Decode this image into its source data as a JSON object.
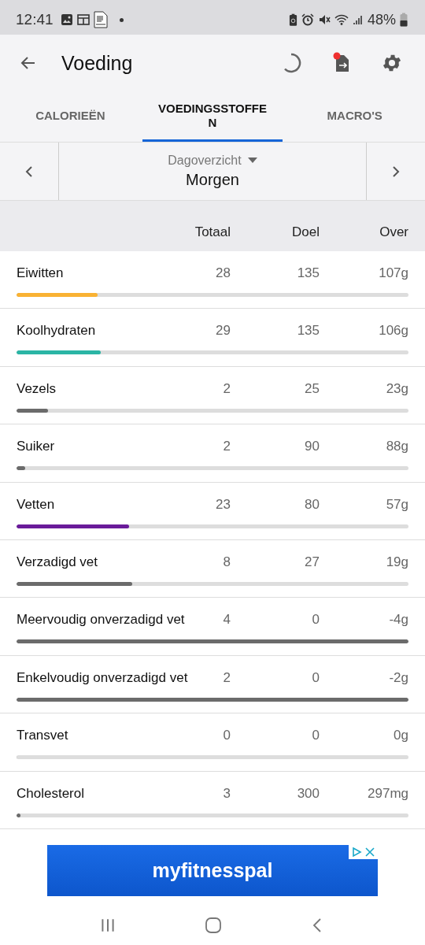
{
  "status_bar": {
    "time": "12:41",
    "battery": "48%"
  },
  "app_bar": {
    "title": "Voeding"
  },
  "tabs": [
    {
      "label": "CALORIEËN",
      "selected": false
    },
    {
      "label": "VOEDINGSSTOFFEN",
      "selected": true
    },
    {
      "label": "MACRO'S",
      "selected": false
    }
  ],
  "date_nav": {
    "view": "Dagoverzicht",
    "day": "Morgen"
  },
  "table": {
    "columns": [
      "Totaal",
      "Doel",
      "Over"
    ],
    "rows": [
      {
        "name": "Eiwitten",
        "total": "28",
        "goal": "135",
        "left": "107g",
        "level": 0.207,
        "color": "#f9b233"
      },
      {
        "name": "Koolhydraten",
        "total": "29",
        "goal": "135",
        "left": "106g",
        "level": 0.215,
        "color": "#2bb5a5"
      },
      {
        "name": "Vezels",
        "total": "2",
        "goal": "25",
        "left": "23g",
        "level": 0.08,
        "color": "#6b6b6b"
      },
      {
        "name": "Suiker",
        "total": "2",
        "goal": "90",
        "left": "88g",
        "level": 0.022,
        "color": "#6b6b6b"
      },
      {
        "name": "Vetten",
        "total": "23",
        "goal": "80",
        "left": "57g",
        "level": 0.288,
        "color": "#6a1b9a"
      },
      {
        "name": "Verzadigd vet",
        "total": "8",
        "goal": "27",
        "left": "19g",
        "level": 0.296,
        "color": "#6b6b6b"
      },
      {
        "name": "Meervoudig onverzadigd vet",
        "total": "4",
        "goal": "0",
        "left": "-4g",
        "level": 1,
        "color": "#6b6b6b"
      },
      {
        "name": "Enkelvoudig onverzadigd vet",
        "total": "2",
        "goal": "0",
        "left": "-2g",
        "level": 1,
        "color": "#6b6b6b"
      },
      {
        "name": "Transvet",
        "total": "0",
        "goal": "0",
        "left": "0g",
        "level": 0
      },
      {
        "name": "Cholesterol",
        "total": "3",
        "goal": "300",
        "left": "297mg",
        "level": 0.01,
        "color": "#6b6b6b"
      }
    ]
  },
  "ad": {
    "brand": "myfitnesspal"
  }
}
